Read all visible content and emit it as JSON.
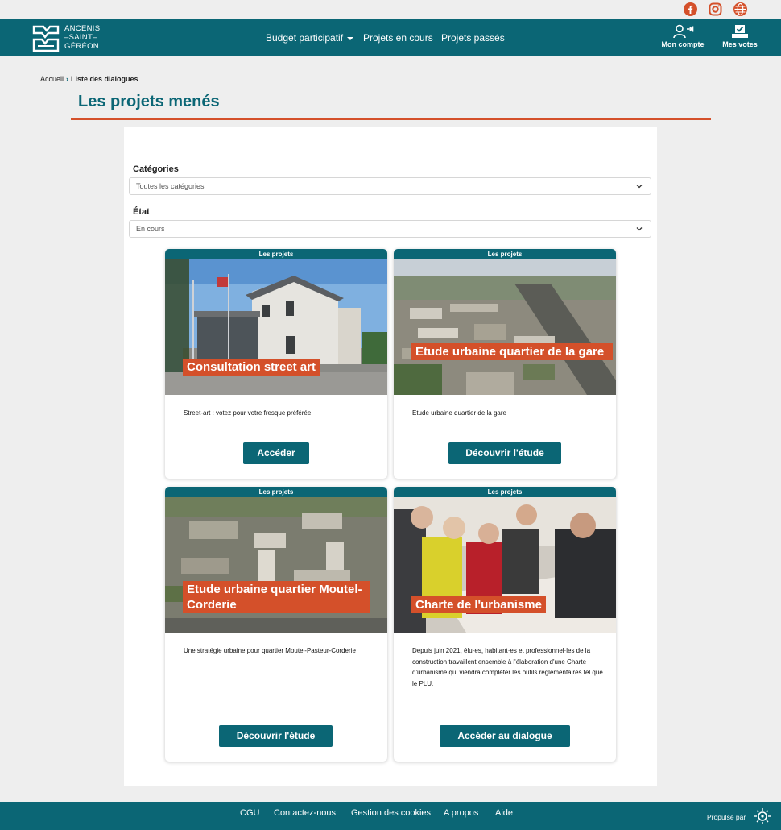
{
  "colors": {
    "primary": "#0b6675",
    "accent": "#d4502a",
    "background": "#eeeeee"
  },
  "social": {
    "icons": [
      "facebook-icon",
      "instagram-icon",
      "globe-icon"
    ]
  },
  "brand": {
    "line1": "ANCENIS",
    "line2": "–SAINT–",
    "line3": "GÉRÉON"
  },
  "nav": {
    "budget": "Budget participatif",
    "current": "Projets en cours",
    "past": "Projets passés",
    "account": "Mon compte",
    "votes": "Mes votes"
  },
  "breadcrumb": {
    "home": "Accueil",
    "current": "Liste des dialogues"
  },
  "page": {
    "title": "Les projets menés"
  },
  "filters": {
    "categories_label": "Catégories",
    "categories_value": "Toutes les catégories",
    "state_label": "État",
    "state_value": "En cours"
  },
  "cards": [
    {
      "tag": "Les projets",
      "title": "Consultation street art",
      "description": "Street-art : votez pour votre fresque préférée",
      "button": "Accéder"
    },
    {
      "tag": "Les projets",
      "title": "Etude urbaine quartier de la gare",
      "description": "Etude urbaine quartier de la gare",
      "button": "Découvrir l'étude"
    },
    {
      "tag": "Les projets",
      "title": "Etude urbaine quartier Moutel-Corderie",
      "description": "Une stratégie urbaine pour quartier Moutel-Pasteur-Corderie",
      "button": "Découvrir l'étude"
    },
    {
      "tag": "Les projets",
      "title": "Charte de l'urbanisme",
      "description": "Depuis juin 2021, élu·es, habitant·es et professionnel·les de la construction travaillent ensemble à l'élaboration d'une Charte d'urbanisme qui viendra compléter les outils réglementaires tel que le PLU.",
      "button": "Accéder au dialogue"
    }
  ],
  "footer": {
    "links": [
      "CGU",
      "Contactez-nous",
      "Gestion des cookies",
      "A propos",
      "Aide"
    ],
    "powered": "Propulsé par"
  }
}
